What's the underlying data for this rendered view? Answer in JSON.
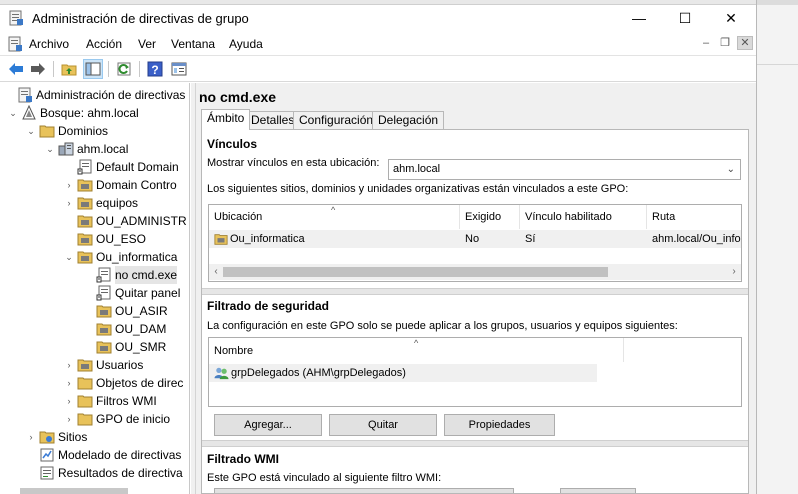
{
  "window": {
    "title": "Administración de directivas de grupo"
  },
  "caption": {
    "minimize": "—",
    "maximize": "☐",
    "close": "✕"
  },
  "menu": {
    "items": [
      "Archivo",
      "Acción",
      "Ver",
      "Ventana",
      "Ayuda"
    ],
    "mdi": {
      "minimize": "–",
      "restore": "❐",
      "close": "✕"
    }
  },
  "toolbar": {
    "buttons": [
      "back-icon",
      "forward-icon",
      "up-folder-icon",
      "show-hide-tree-icon",
      "refresh-icon",
      "help-icon",
      "properties-panel-icon"
    ]
  },
  "tree": {
    "items": [
      {
        "label": "Administración de directivas de grupo",
        "icon": "gpmc-icon",
        "twisty": ""
      },
      {
        "label": "Bosque: ahm.local",
        "icon": "forest-icon",
        "twisty": "⌄"
      },
      {
        "label": "Dominios",
        "icon": "folder-icon",
        "twisty": "⌄"
      },
      {
        "label": "ahm.local",
        "icon": "domain-icon",
        "twisty": "⌄"
      },
      {
        "label": "Default Domain",
        "icon": "gpo-link-icon",
        "twisty": ""
      },
      {
        "label": "Domain Contro",
        "icon": "ou-icon",
        "twisty": "›"
      },
      {
        "label": "equipos",
        "icon": "ou-icon",
        "twisty": "›"
      },
      {
        "label": "OU_ADMINISTR",
        "icon": "ou-icon",
        "twisty": ""
      },
      {
        "label": "OU_ESO",
        "icon": "ou-icon",
        "twisty": ""
      },
      {
        "label": "Ou_informatica",
        "icon": "ou-icon",
        "twisty": "⌄"
      },
      {
        "label": "no cmd.exe",
        "icon": "gpo-link-icon",
        "twisty": ""
      },
      {
        "label": "Quitar panel",
        "icon": "gpo-link-icon",
        "twisty": ""
      },
      {
        "label": "OU_ASIR",
        "icon": "ou-icon",
        "twisty": ""
      },
      {
        "label": "OU_DAM",
        "icon": "ou-icon",
        "twisty": ""
      },
      {
        "label": "OU_SMR",
        "icon": "ou-icon",
        "twisty": ""
      },
      {
        "label": "Usuarios",
        "icon": "ou-icon",
        "twisty": "›"
      },
      {
        "label": "Objetos de direc",
        "icon": "folder-icon",
        "twisty": "›"
      },
      {
        "label": "Filtros WMI",
        "icon": "folder-icon",
        "twisty": "›"
      },
      {
        "label": "GPO de inicio",
        "icon": "folder-icon",
        "twisty": "›"
      },
      {
        "label": "Sitios",
        "icon": "sites-icon",
        "twisty": "›"
      },
      {
        "label": "Modelado de directivas",
        "icon": "modeling-icon",
        "twisty": ""
      },
      {
        "label": "Resultados de directiva",
        "icon": "results-icon",
        "twisty": ""
      }
    ]
  },
  "gpo": {
    "name": "no cmd.exe"
  },
  "tabs": [
    "Ámbito",
    "Detalles",
    "Configuración",
    "Delegación"
  ],
  "links": {
    "title": "Vínculos",
    "show_label": "Mostrar vínculos en esta ubicación:",
    "location_value": "ahm.local",
    "description": "Los siguientes sitios, dominios y unidades organizativas están vinculados a este GPO:",
    "columns": [
      "Ubicación",
      "Exigido",
      "Vínculo habilitado",
      "Ruta"
    ],
    "rows": [
      {
        "location": "Ou_informatica",
        "enforced": "No",
        "enabled": "Sí",
        "path": "ahm.local/Ou_informatica"
      }
    ]
  },
  "security": {
    "title": "Filtrado de seguridad",
    "description": "La configuración en este GPO solo se puede aplicar a los grupos, usuarios y equipos siguientes:",
    "column": "Nombre",
    "rows": [
      "grpDelegados (AHM\\grpDelegados)"
    ],
    "buttons": {
      "add": "Agregar...",
      "remove": "Quitar",
      "properties": "Propiedades"
    }
  },
  "wmi": {
    "title": "Filtrado WMI",
    "description": "Este GPO está vinculado al siguiente filtro WMI:"
  }
}
